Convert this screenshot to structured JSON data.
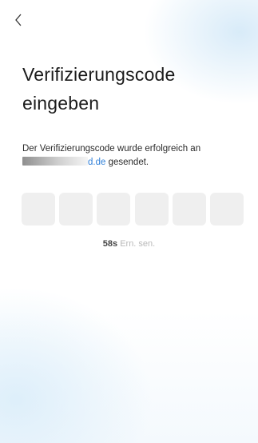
{
  "nav": {
    "back_icon": "chevron-left-icon"
  },
  "heading": {
    "title_line1": "Verifizierungscode",
    "title_line2": "eingeben"
  },
  "message": {
    "text_line1": "Der Verifizierungscode wurde erfolgreich an",
    "email_partial": "d.de",
    "text_line2_suffix": "gesendet."
  },
  "code_inputs": {
    "count": 6,
    "values": [
      "",
      "",
      "",
      "",
      "",
      ""
    ]
  },
  "resend": {
    "timer": "58s",
    "label": "Ern. sen."
  },
  "colors": {
    "accent": "#2f7fd8",
    "box": "#efefef",
    "muted": "#b9b9b9"
  }
}
